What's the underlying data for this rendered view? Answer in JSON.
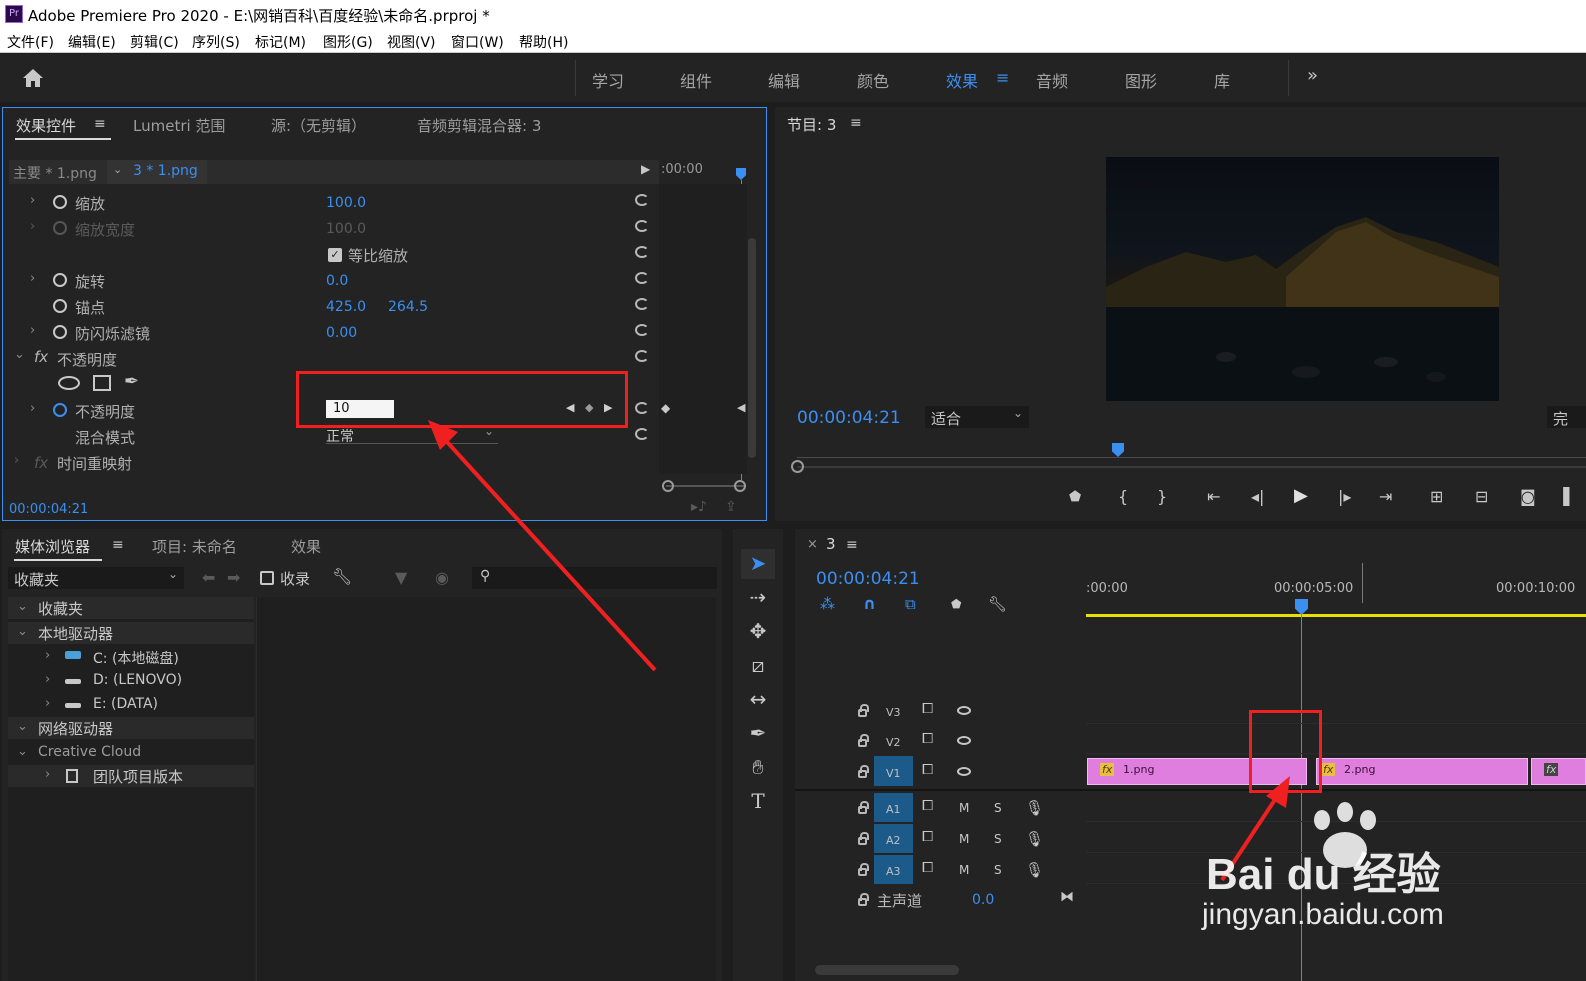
{
  "title_bar": {
    "app_icon": "Pr",
    "title": "Adobe Premiere Pro 2020 - E:\\网销百科\\百度经验\\未命名.prproj *"
  },
  "menu": [
    "文件(F)",
    "编辑(E)",
    "剪辑(C)",
    "序列(S)",
    "标记(M)",
    "图形(G)",
    "视图(V)",
    "窗口(W)",
    "帮助(H)"
  ],
  "workspaces": [
    "学习",
    "组件",
    "编辑",
    "颜色",
    "效果",
    "音频",
    "图形",
    "库"
  ],
  "workspaces_active": "效果",
  "workspaces_more": "»",
  "effect_controls": {
    "tabs": [
      "效果控件",
      "Lumetri 范围",
      "源:（无剪辑）",
      "音频剪辑混合器: 3"
    ],
    "master_label": "主要 * 1.png",
    "clip_label": "3 * 1.png",
    "ruler_time": ":00:00",
    "properties": [
      {
        "name": "缩放",
        "value": "100.0"
      },
      {
        "name": "缩放宽度",
        "value": "100.0"
      },
      {
        "name": "等比缩放",
        "value": ""
      },
      {
        "name": "旋转",
        "value": "0.0"
      },
      {
        "name": "锚点",
        "value": "425.0",
        "value2": "264.5"
      },
      {
        "name": "防闪烁滤镜",
        "value": "0.00"
      },
      {
        "name": "不透明度",
        "value": ""
      },
      {
        "name": "不透明度",
        "value": "10"
      },
      {
        "name": "混合模式",
        "value": "正常"
      },
      {
        "name": "时间重映射",
        "value": ""
      }
    ],
    "fx_label": "fx",
    "timecode": "00:00:04:21"
  },
  "program_monitor": {
    "tab": "节目: 3",
    "timecode": "00:00:04:21",
    "fit": "适合",
    "full_label": "完"
  },
  "media_browser": {
    "tabs": [
      "媒体浏览器",
      "项目: 未命名",
      "效果"
    ],
    "dropdown": "收藏夹",
    "ingest": "收录",
    "tree": [
      {
        "label": "收藏夹",
        "level": 0
      },
      {
        "label": "本地驱动器",
        "level": 0
      },
      {
        "label": "C: (本地磁盘)",
        "level": 1
      },
      {
        "label": "D: (LENOVO)",
        "level": 1
      },
      {
        "label": "E: (DATA)",
        "level": 1
      },
      {
        "label": "网络驱动器",
        "level": 0
      },
      {
        "label": "Creative Cloud",
        "level": 0
      },
      {
        "label": "团队项目版本",
        "level": 1
      }
    ]
  },
  "timeline": {
    "close": "×",
    "tab": "3",
    "timecode": "00:00:04:21",
    "ruler": [
      ":00:00",
      "00:00:05:00",
      "00:00:10:00"
    ],
    "tracks": [
      {
        "name": "V3"
      },
      {
        "name": "V2"
      },
      {
        "name": "V1"
      },
      {
        "name": "A1"
      },
      {
        "name": "A2"
      },
      {
        "name": "A3"
      }
    ],
    "track_m": "M",
    "track_s": "S",
    "master_label": "主声道",
    "master_value": "0.0",
    "clip1": "1.png",
    "clip2": "2.png"
  },
  "watermark": {
    "brand": "Bai du 经验",
    "url": "jingyan.baidu.com"
  },
  "colors": {
    "accent": "#3b8ff0",
    "clip": "#e07ee0",
    "highlight": "#f02020",
    "work_area": "#e8e000"
  }
}
